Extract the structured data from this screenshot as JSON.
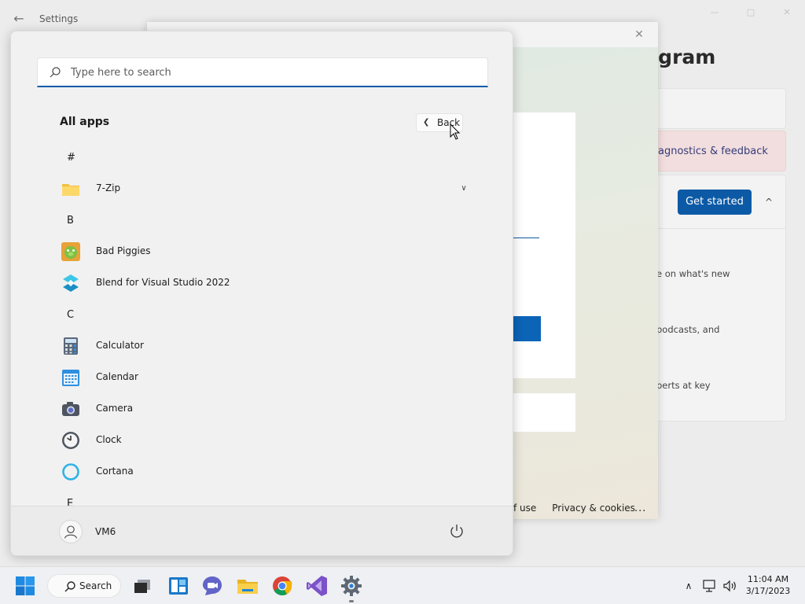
{
  "settings": {
    "title": "Settings",
    "heading": "ogram",
    "diagnostics_label": "agnostics & feedback",
    "get_started_label": "Get started",
    "text_lines": [
      "e on what's new",
      "podcasts, and",
      "perts at key"
    ]
  },
  "dialog": {
    "footer_links": [
      "f use",
      "Privacy & cookies"
    ],
    "more": "..."
  },
  "start_menu": {
    "search_placeholder": "Type here to search",
    "section_title": "All apps",
    "back_label": "Back",
    "letters": [
      "#",
      "B",
      "C",
      "E"
    ],
    "apps": [
      {
        "name": "7-Zip",
        "icon": "folder-icon",
        "expandable": true
      },
      {
        "name": "Bad Piggies",
        "icon": "bad-piggies-icon"
      },
      {
        "name": "Blend for Visual Studio 2022",
        "icon": "blend-icon"
      },
      {
        "name": "Calculator",
        "icon": "calculator-icon"
      },
      {
        "name": "Calendar",
        "icon": "calendar-icon"
      },
      {
        "name": "Camera",
        "icon": "camera-icon"
      },
      {
        "name": "Clock",
        "icon": "clock-icon"
      },
      {
        "name": "Cortana",
        "icon": "cortana-icon"
      }
    ],
    "user_name": "VM6"
  },
  "taskbar": {
    "search_label": "Search",
    "time": "11:04 AM",
    "date": "3/17/2023",
    "pinned": [
      "start-icon",
      "task-view-icon",
      "widgets-icon",
      "teams-chat-icon",
      "file-explorer-icon",
      "chrome-icon",
      "visual-studio-icon",
      "settings-icon"
    ]
  },
  "colors": {
    "accent": "#0c5aa6",
    "start_bg": "#f1f1f1",
    "taskbar_bg": "#eef0f3",
    "diagnostics_bg": "#f2dede"
  }
}
